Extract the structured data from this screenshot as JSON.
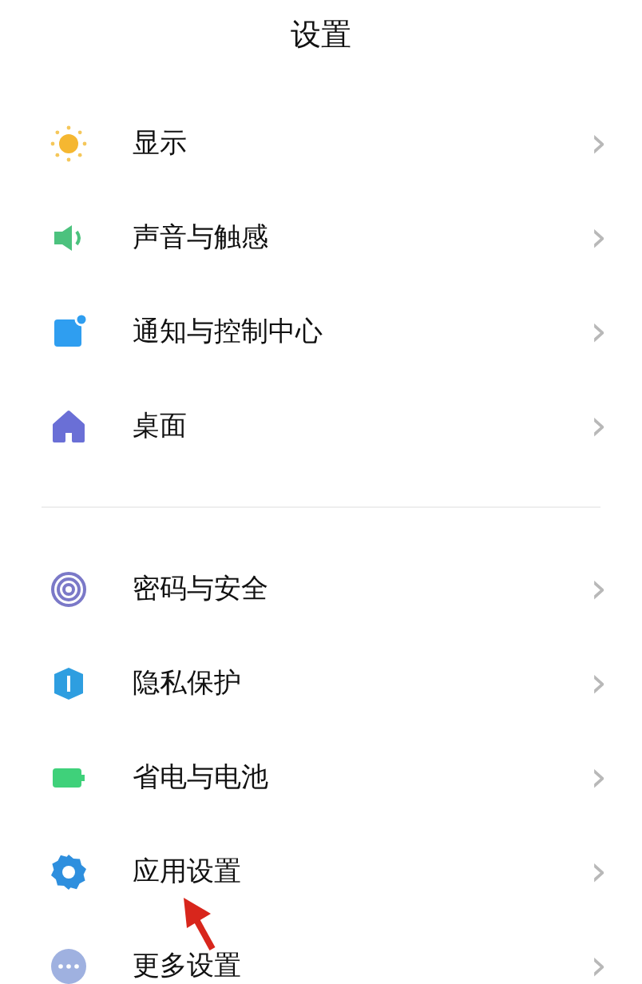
{
  "title": "设置",
  "groups": [
    {
      "items": [
        {
          "kind": "sun",
          "label": "显示",
          "chevron": "›"
        },
        {
          "kind": "speaker",
          "label": "声音与触感",
          "chevron": "›"
        },
        {
          "kind": "notification",
          "label": "通知与控制中心",
          "chevron": "›"
        },
        {
          "kind": "home",
          "label": "桌面",
          "chevron": "›"
        }
      ]
    },
    {
      "items": [
        {
          "kind": "fingerprint",
          "label": "密码与安全",
          "chevron": "›"
        },
        {
          "kind": "shield",
          "label": "隐私保护",
          "chevron": "›"
        },
        {
          "kind": "battery",
          "label": "省电与电池",
          "chevron": "›"
        },
        {
          "kind": "gear",
          "label": "应用设置",
          "chevron": "›"
        },
        {
          "kind": "more",
          "label": "更多设置",
          "chevron": "›"
        }
      ]
    }
  ],
  "annotation_arrow": true
}
